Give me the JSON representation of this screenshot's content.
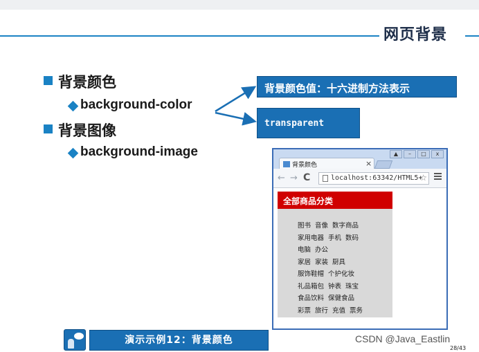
{
  "slide": {
    "title": "网页背景",
    "bullets": [
      {
        "label": "背景颜色",
        "sub": "background-color"
      },
      {
        "label": "背景图像",
        "sub": "background-image"
      }
    ],
    "callouts": {
      "color_value": "背景颜色值：十六进制方法表示",
      "transparent": "transparent"
    },
    "demo_button": "演示示例12：背景颜色",
    "watermark": "CSDN @Java_Eastlin",
    "page_number": "28/43"
  },
  "browser": {
    "tab_title": "背景颜色",
    "tab_close": "×",
    "window_controls": [
      "▲",
      "–",
      "□",
      "x"
    ],
    "url": "localhost:63342/HTML5+",
    "nav": {
      "back": "←",
      "forward": "→",
      "reload": "C",
      "bookmark": "☆"
    },
    "category": {
      "header": "全部商品分类",
      "items": [
        "图书 音像 数字商品",
        "家用电器 手机 数码",
        "电脑 办公",
        "家居 家装 厨具",
        "服饰鞋帽 个护化妆",
        "礼品箱包 钟表 珠宝",
        "食品饮料 保健食品",
        "彩票 旅行 充值 票务"
      ]
    }
  },
  "colors": {
    "accent": "#1a82c4",
    "callout": "#1a6fb4",
    "category_header": "#d00000",
    "category_bg": "#d9d9d9"
  },
  "icons": {
    "bullet": "square-bullet-icon",
    "sub_bullet": "diamond-icon",
    "demo": "presenter-icon"
  }
}
